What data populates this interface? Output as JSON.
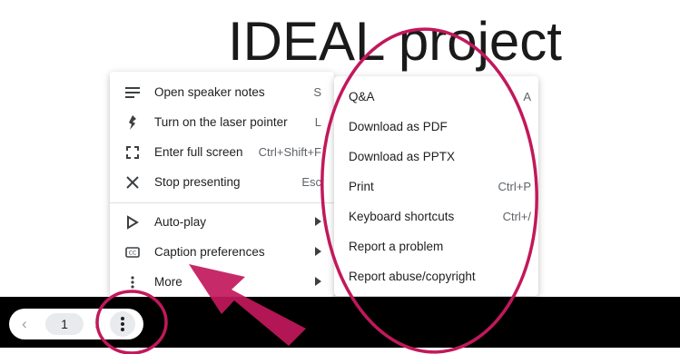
{
  "slide": {
    "title": "IDEAL project"
  },
  "pager": {
    "prev_icon": "‹",
    "page_number": "1",
    "next_icon": "›"
  },
  "menu": {
    "items": [
      {
        "label": "Open speaker notes",
        "shortcut": "S",
        "icon": "notes-lines-icon"
      },
      {
        "label": "Turn on the laser pointer",
        "shortcut": "L",
        "icon": "laser-pointer-icon"
      },
      {
        "label": "Enter full screen",
        "shortcut": "Ctrl+Shift+F",
        "icon": "fullscreen-icon"
      },
      {
        "label": "Stop presenting",
        "shortcut": "Esc",
        "icon": "close-x-icon"
      },
      {
        "label": "Auto-play",
        "icon": "play-outline-icon"
      },
      {
        "label": "Caption preferences",
        "icon": "closed-caption-icon"
      },
      {
        "label": "More",
        "icon": "more-vert-icon"
      }
    ]
  },
  "submenu": {
    "items": [
      {
        "label": "Q&A",
        "shortcut": "A"
      },
      {
        "label": "Download as PDF",
        "shortcut": ""
      },
      {
        "label": "Download as PPTX",
        "shortcut": ""
      },
      {
        "label": "Print",
        "shortcut": "Ctrl+P"
      },
      {
        "label": "Keyboard shortcuts",
        "shortcut": "Ctrl+/"
      },
      {
        "label": "Report a problem",
        "shortcut": ""
      },
      {
        "label": "Report abuse/copyright",
        "shortcut": ""
      }
    ]
  },
  "colors": {
    "annotation": "#c2185b",
    "arrow": "#c2185b",
    "black_bar": "#000000"
  }
}
